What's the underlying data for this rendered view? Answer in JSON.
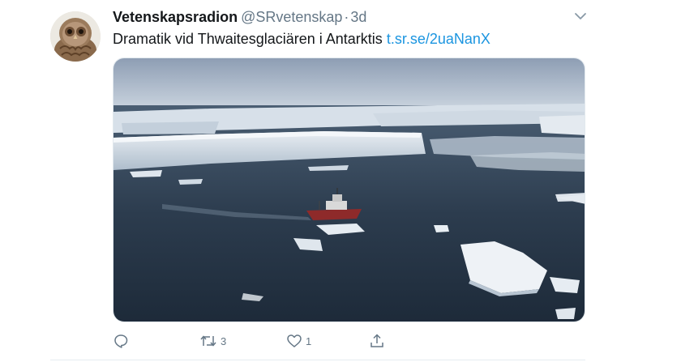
{
  "tweet": {
    "display_name": "Vetenskapsradion",
    "handle": "@SRvetenskap",
    "separator": "·",
    "time": "3d",
    "text": "Dramatik vid Thwaitesglaciären i Antarktis",
    "link": "t.sr.se/2uaNanX",
    "avatar_icon": "owl-avatar",
    "menu_icon": "chevron-down-icon"
  },
  "media": {
    "type": "photo",
    "subject": "aerial-antarctic-ice-shelf-with-ship"
  },
  "actions": {
    "reply_count": "",
    "retweet_count": "3",
    "like_count": "1",
    "share_count": ""
  },
  "colors": {
    "accent": "#1b95e0",
    "muted": "#657786",
    "text": "#14171a"
  }
}
